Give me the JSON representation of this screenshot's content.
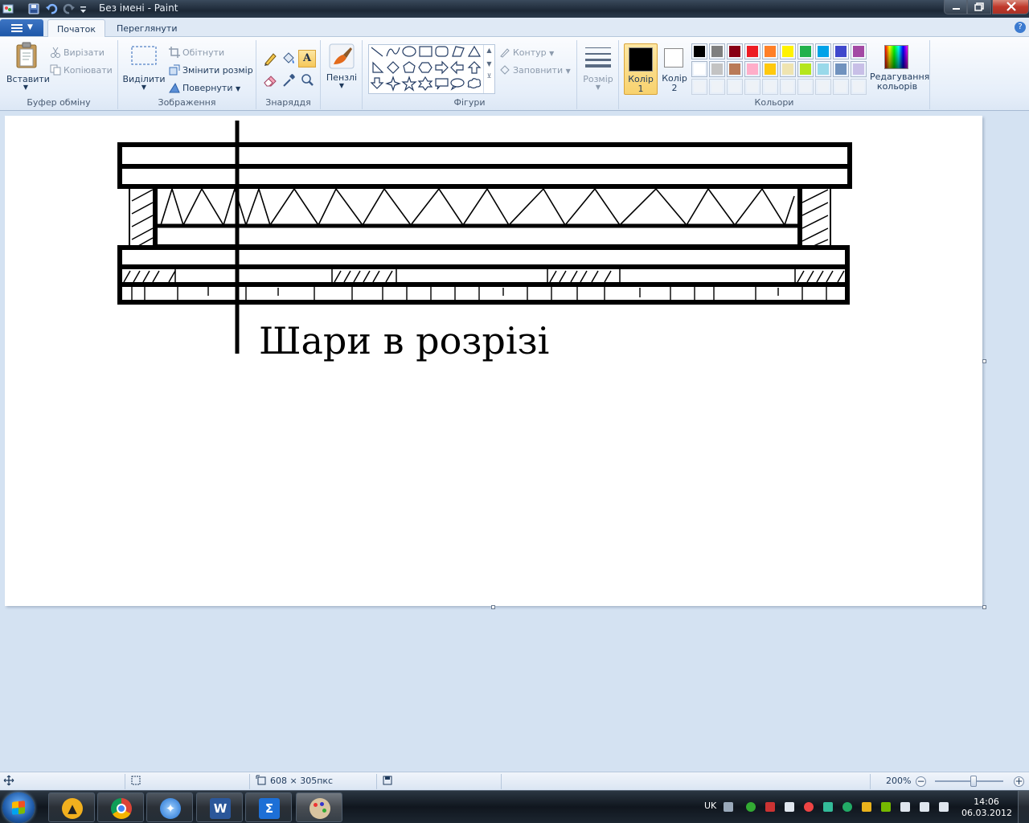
{
  "window": {
    "title": "Без імені - Paint"
  },
  "tabs": [
    {
      "label": "Початок"
    },
    {
      "label": "Переглянути"
    }
  ],
  "ribbon": {
    "clipboard": {
      "label": "Буфер обміну",
      "paste": "Вставити",
      "cut": "Вирізати",
      "copy": "Копіювати"
    },
    "image": {
      "label": "Зображення",
      "select": "Виділити",
      "crop": "Обітнути",
      "resize": "Змінити розмір",
      "rotate": "Повернути"
    },
    "tools": {
      "label": "Знаряддя"
    },
    "brushes": {
      "label": "Пензлі"
    },
    "shapes": {
      "label": "Фігури",
      "outline": "Контур",
      "fill": "Заповнити"
    },
    "size": {
      "label": "Розмір"
    },
    "colors": {
      "label": "Кольори",
      "color1": "Колір 1",
      "color2": "Колір 2",
      "edit": "Редагування кольорів",
      "palette_row1": [
        "#000000",
        "#7f7f7f",
        "#880015",
        "#ed1c24",
        "#ff7f27",
        "#fff200",
        "#22b14c",
        "#00a2e8",
        "#3f48cc",
        "#a349a4"
      ],
      "palette_row2": [
        "#ffffff",
        "#c3c3c3",
        "#b97a57",
        "#ffaec9",
        "#ffc90e",
        "#efe4b0",
        "#b5e61d",
        "#99d9ea",
        "#7092be",
        "#c8bfe7"
      ]
    }
  },
  "canvas": {
    "caption": "Шари в розрізі"
  },
  "statusbar": {
    "dimensions": "608 × 305пкс",
    "zoom": "200%"
  },
  "taskbar": {
    "language": "UK",
    "time": "14:06",
    "date": "06.03.2012"
  }
}
